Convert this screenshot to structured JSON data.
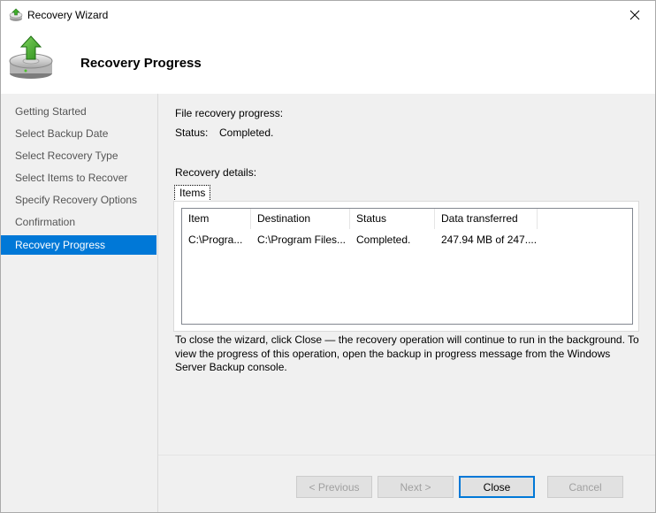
{
  "window": {
    "title": "Recovery Wizard"
  },
  "header": {
    "title": "Recovery Progress"
  },
  "sidebar": {
    "items": [
      {
        "label": "Getting Started"
      },
      {
        "label": "Select Backup Date"
      },
      {
        "label": "Select Recovery Type"
      },
      {
        "label": "Select Items to Recover"
      },
      {
        "label": "Specify Recovery Options"
      },
      {
        "label": "Confirmation"
      },
      {
        "label": "Recovery Progress",
        "active": true
      }
    ]
  },
  "main": {
    "progress_label": "File recovery progress:",
    "status_label": "Status:",
    "status_value": "Completed.",
    "details_label": "Recovery details:",
    "tab_label": "Items",
    "table": {
      "columns": [
        "Item",
        "Destination",
        "Status",
        "Data transferred"
      ],
      "rows": [
        [
          "C:\\Progra...",
          "C:\\Program Files...",
          "Completed.",
          "247.94 MB of 247...."
        ]
      ]
    },
    "note": "To close the wizard, click Close — the recovery operation will continue to run in the background. To view the progress of this operation, open the backup in progress message from the Windows Server Backup console."
  },
  "buttons": {
    "previous": "< Previous",
    "next": "Next >",
    "close": "Close",
    "cancel": "Cancel"
  },
  "colors": {
    "accent": "#0078d7",
    "panel": "#f0f0f0"
  }
}
